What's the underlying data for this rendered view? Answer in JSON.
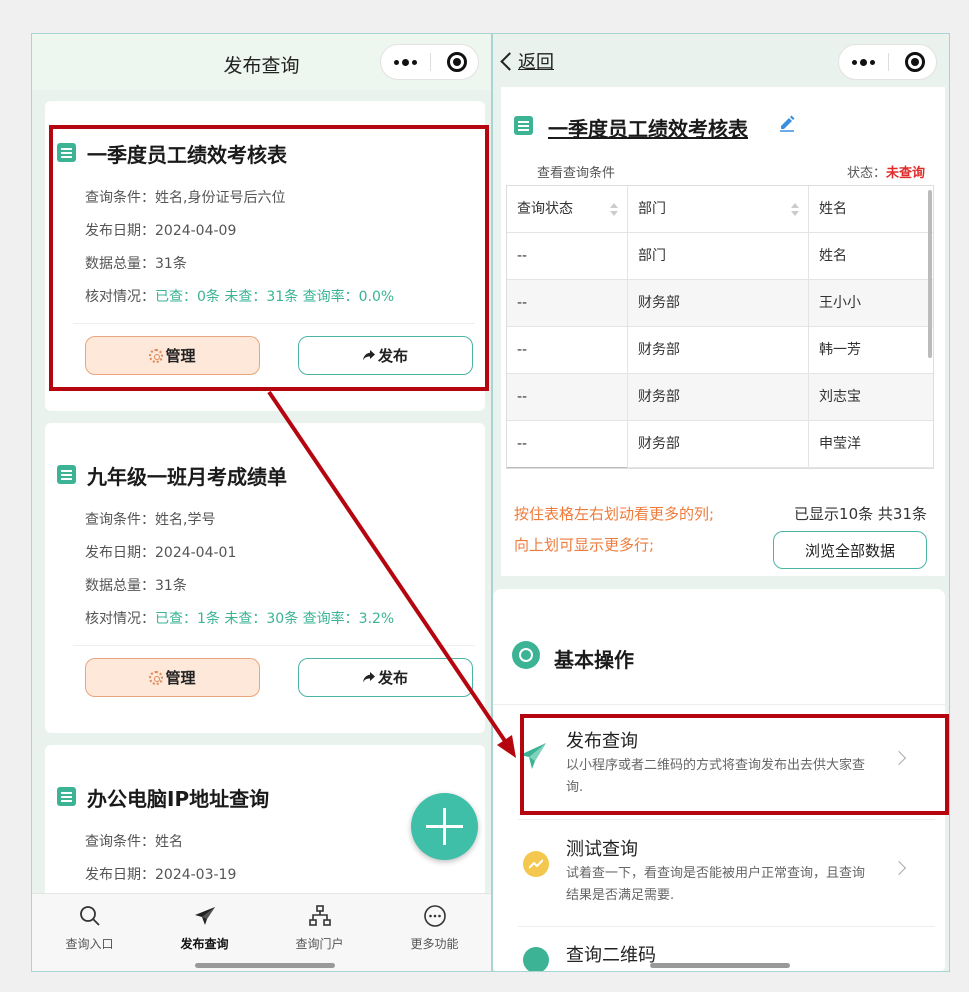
{
  "left": {
    "nav_title": "发布查询",
    "cards": [
      {
        "title": "一季度员工绩效考核表",
        "conditions_label": "查询条件：",
        "conditions": "姓名,身份证号后六位",
        "date_label": "发布日期：",
        "date": "2024-04-09",
        "total_label": "数据总量：",
        "total": "31条",
        "check_label": "核对情况：",
        "checked": "已查：0条",
        "unchecked": "未查：31条",
        "rate": "查询率：0.0%",
        "manage_label": "管理",
        "publish_label": "发布"
      },
      {
        "title": "九年级一班月考成绩单",
        "conditions_label": "查询条件：",
        "conditions": "姓名,学号",
        "date_label": "发布日期：",
        "date": "2024-04-01",
        "total_label": "数据总量：",
        "total": "31条",
        "check_label": "核对情况：",
        "checked": "已查：1条",
        "unchecked": "未查：30条",
        "rate": "查询率：3.2%",
        "manage_label": "管理",
        "publish_label": "发布"
      },
      {
        "title": "办公电脑IP地址查询",
        "conditions_label": "查询条件：",
        "conditions": "姓名",
        "date_label": "发布日期：",
        "date": "2024-03-19"
      }
    ],
    "tabs": [
      {
        "label": "查询入口",
        "icon": "search-icon"
      },
      {
        "label": "发布查询",
        "icon": "paper-plane-icon"
      },
      {
        "label": "查询门户",
        "icon": "sitemap-icon"
      },
      {
        "label": "更多功能",
        "icon": "more-icon"
      }
    ],
    "active_tab": "发布查询"
  },
  "right": {
    "back_label": "返回",
    "title": "一季度员工绩效考核表",
    "conditions_link": "查看查询条件",
    "status_label": "状态：",
    "status_value": "未查询",
    "table": {
      "headers": [
        "查询状态",
        "部门",
        "姓名"
      ],
      "rows": [
        [
          "--",
          "部门",
          "姓名"
        ],
        [
          "--",
          "财务部",
          "王小小"
        ],
        [
          "--",
          "财务部",
          "韩一芳"
        ],
        [
          "--",
          "财务部",
          "刘志宝"
        ],
        [
          "--",
          "财务部",
          "申莹洋"
        ]
      ]
    },
    "hint_line1": "按住表格左右划动看更多的列;",
    "hint_line2": "向上划可显示更多行;",
    "shown_count": "已显示10条 共31条",
    "browse_all": "浏览全部数据",
    "section_title": "基本操作",
    "operations": [
      {
        "title": "发布查询",
        "desc": "以小程序或者二维码的方式将查询发布出去供大家查询."
      },
      {
        "title": "测试查询",
        "desc": "试着查一下，看查询是否能被用户正常查询，且查询结果是否满足需要."
      },
      {
        "title": "查询二维码",
        "desc": ""
      }
    ]
  },
  "colors": {
    "accent": "#3bb394",
    "annotation": "#b5050f",
    "warning": "#ef7b3b",
    "status_red": "#e12b2b"
  }
}
